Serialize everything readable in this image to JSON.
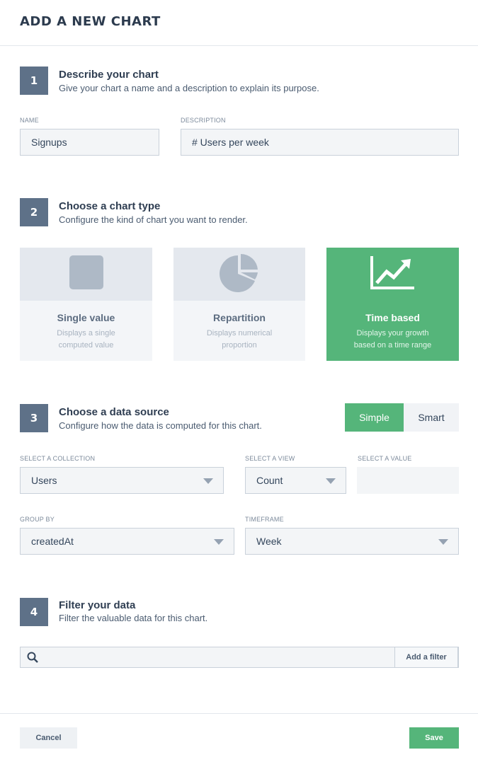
{
  "header": {
    "title": "ADD A NEW CHART"
  },
  "steps": [
    {
      "number": "1",
      "title": "Describe your chart",
      "subtitle": "Give your chart a name and a description to explain its purpose."
    },
    {
      "number": "2",
      "title": "Choose a chart type",
      "subtitle": "Configure the kind of chart you want to render."
    },
    {
      "number": "3",
      "title": "Choose a data source",
      "subtitle": "Configure how the data is computed for this chart."
    },
    {
      "number": "4",
      "title": "Filter your data",
      "subtitle": "Filter the valuable data for this chart."
    }
  ],
  "describe": {
    "name_label": "NAME",
    "name_value": "Signups",
    "description_label": "DESCRIPTION",
    "description_value": "# Users per week"
  },
  "chart_types": [
    {
      "title": "Single value",
      "desc_line1": "Displays a single",
      "desc_line2": "computed value",
      "icon": "square-icon",
      "selected": false
    },
    {
      "title": "Repartition",
      "desc_line1": "Displays numerical",
      "desc_line2": "proportion",
      "icon": "pie-chart-icon",
      "selected": false
    },
    {
      "title": "Time based",
      "desc_line1": "Displays your growth",
      "desc_line2": "based on a time range",
      "icon": "line-chart-icon",
      "selected": true
    }
  ],
  "source": {
    "mode_simple": "Simple",
    "mode_smart": "Smart",
    "active_mode": "Simple",
    "collection_label": "SELECT A COLLECTION",
    "collection_value": "Users",
    "view_label": "SELECT A VIEW",
    "view_value": "Count",
    "value_label": "SELECT A VALUE",
    "group_by_label": "GROUP BY",
    "group_by_value": "createdAt",
    "timeframe_label": "TIMEFRAME",
    "timeframe_value": "Week"
  },
  "filter": {
    "add_label": "Add a filter"
  },
  "footer": {
    "cancel_label": "Cancel",
    "save_label": "Save"
  },
  "colors": {
    "accent_green": "#55b57a",
    "step_badge": "#5e7188",
    "input_bg": "#f3f5f7"
  }
}
